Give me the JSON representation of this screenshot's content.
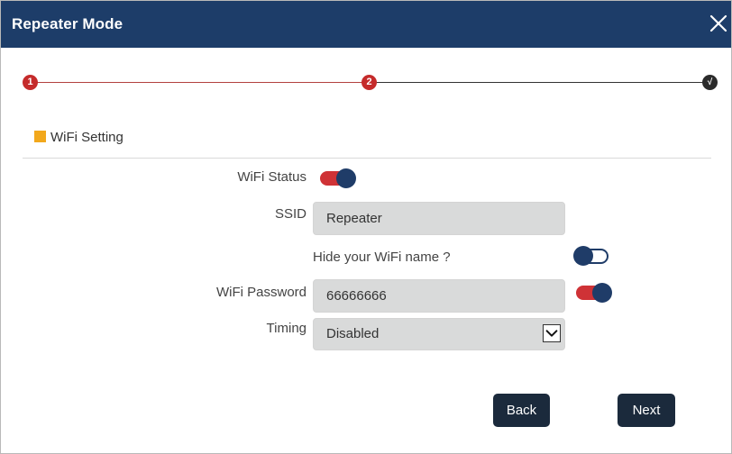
{
  "window": {
    "title": "Repeater Mode",
    "close_icon": "close-icon"
  },
  "stepper": {
    "steps": [
      {
        "label": "1",
        "state": "done",
        "color": "#c52b2b"
      },
      {
        "label": "2",
        "state": "current",
        "color": "#c52b2b"
      },
      {
        "label": "√",
        "state": "pending",
        "color": "#2b2b2b"
      }
    ]
  },
  "section": {
    "title": "WiFi Setting",
    "accent": "#f2a81c"
  },
  "form": {
    "wifi_status": {
      "label": "WiFi Status",
      "on": true
    },
    "ssid": {
      "label": "SSID",
      "value": "Repeater"
    },
    "hide_name": {
      "label": "Hide your WiFi name ?",
      "on": false
    },
    "password": {
      "label": "WiFi Password",
      "value": "66666666",
      "show": true
    },
    "timing": {
      "label": "Timing",
      "value": "Disabled"
    }
  },
  "buttons": {
    "back": "Back",
    "next": "Next"
  },
  "colors": {
    "header": "#1d3d69",
    "toggle_on_track": "#cf3236",
    "toggle_knob": "#1f3c68",
    "button": "#1b2a3c"
  }
}
